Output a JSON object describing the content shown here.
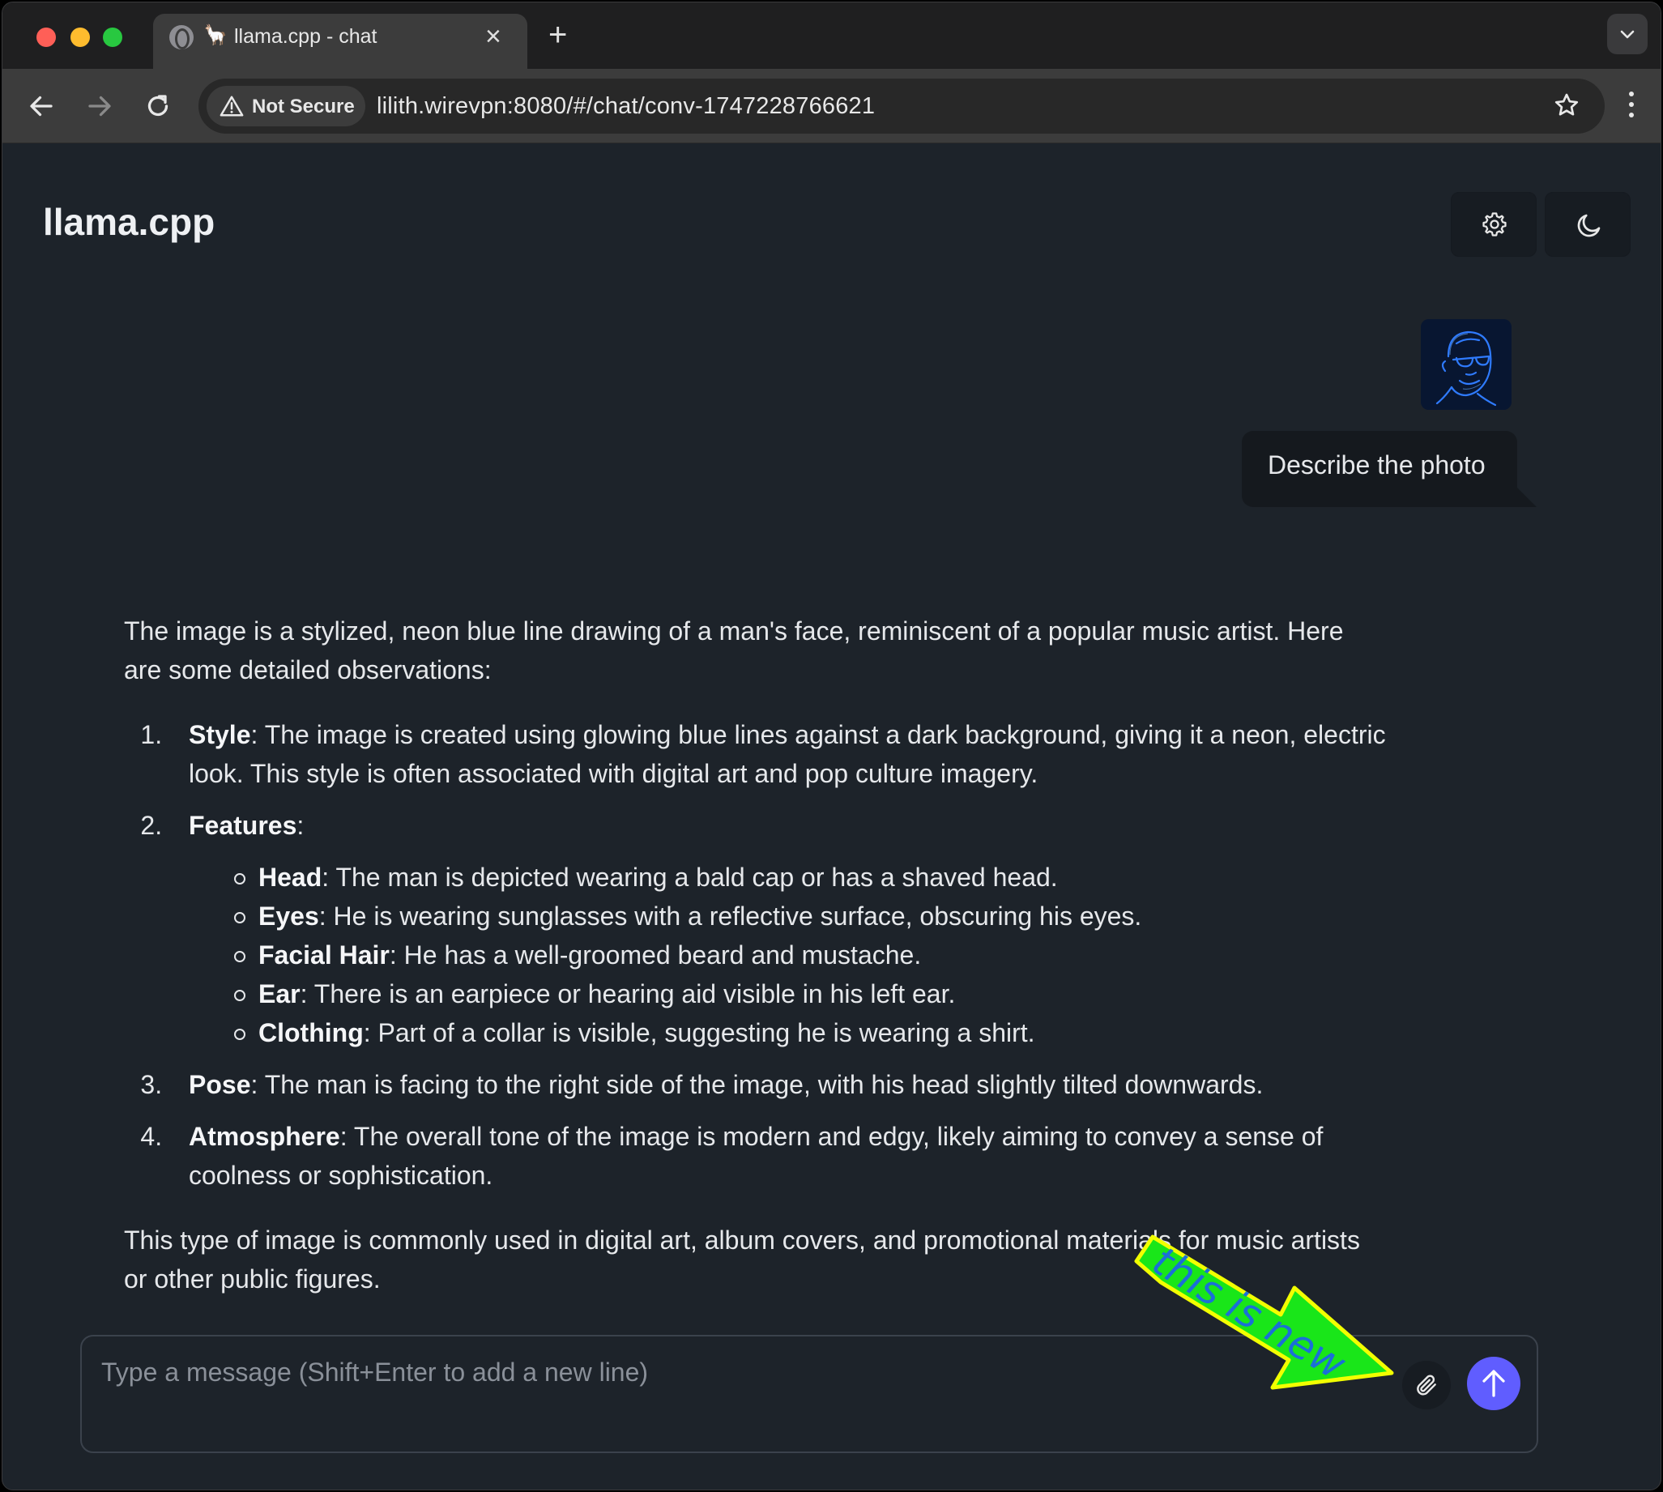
{
  "browser": {
    "tab_title": "llama.cpp - chat",
    "tab_favicon": "🦙",
    "tab_close": "×",
    "new_tab": "+",
    "security_label": "Not Secure",
    "url": "lilith.wirevpn:8080/#/chat/conv-1747228766621"
  },
  "app": {
    "title": "llama.cpp",
    "accent_color": "#605dff"
  },
  "conversation": {
    "user_message": "Describe the photo",
    "assistant": {
      "intro": "The image is a stylized, neon blue line drawing of a man's face, reminiscent of a popular music artist. Here are some detailed observations:",
      "items": [
        {
          "label": "Style",
          "text": ": The image is created using glowing blue lines against a dark background, giving it a neon, electric look. This style is often associated with digital art and pop culture imagery."
        },
        {
          "label": "Features",
          "text": ":",
          "sub": [
            {
              "label": "Head",
              "text": ": The man is depicted wearing a bald cap or has a shaved head."
            },
            {
              "label": "Eyes",
              "text": ": He is wearing sunglasses with a reflective surface, obscuring his eyes."
            },
            {
              "label": "Facial Hair",
              "text": ": He has a well-groomed beard and mustache."
            },
            {
              "label": "Ear",
              "text": ": There is an earpiece or hearing aid visible in his left ear."
            },
            {
              "label": "Clothing",
              "text": ": Part of a collar is visible, suggesting he is wearing a shirt."
            }
          ]
        },
        {
          "label": "Pose",
          "text": ": The man is facing to the right side of the image, with his head slightly tilted downwards."
        },
        {
          "label": "Atmosphere",
          "text": ": The overall tone of the image is modern and edgy, likely aiming to convey a sense of coolness or sophistication."
        }
      ],
      "outro": "This type of image is commonly used in digital art, album covers, and promotional materials for music artists or other public figures."
    }
  },
  "composer": {
    "placeholder": "Type a message (Shift+Enter to add a new line)",
    "value": ""
  },
  "annotation": {
    "text": "this is new",
    "fill": "#19e619",
    "text_color": "#1b6fd8"
  },
  "icons": [
    "globe-icon",
    "close-icon",
    "plus-icon",
    "chevron-down-icon",
    "back-arrow-icon",
    "forward-arrow-icon",
    "reload-icon",
    "warning-icon",
    "star-icon",
    "kebab-menu-icon",
    "gear-icon",
    "moon-icon",
    "paperclip-icon",
    "arrow-up-icon"
  ]
}
